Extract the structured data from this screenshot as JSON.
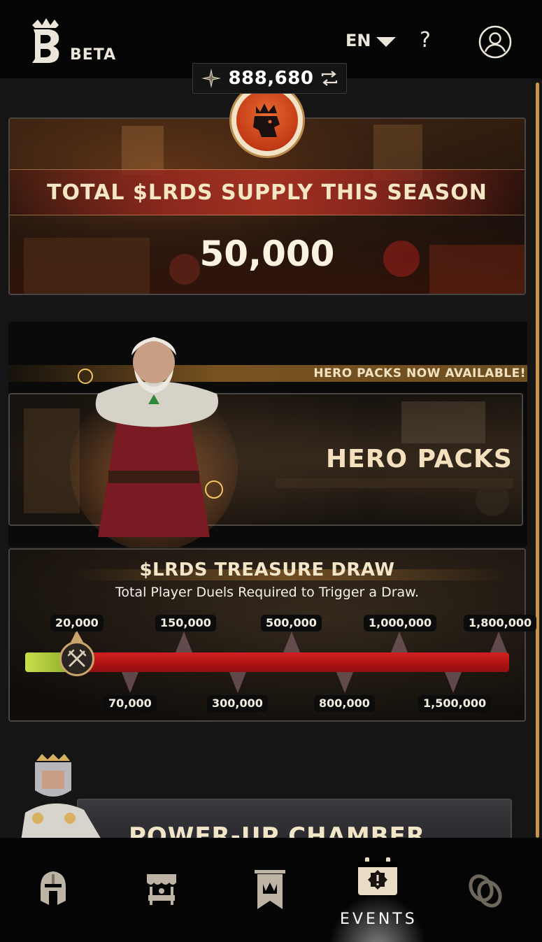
{
  "header": {
    "beta_label": "BETA",
    "language": "EN",
    "help_label": "?"
  },
  "balance": {
    "amount": "888,680"
  },
  "supply_card": {
    "title": "TOTAL $LRDS SUPPLY THIS SEASON",
    "amount": "50,000"
  },
  "hero_packs": {
    "banner": "HERO PACKS NOW AVAILABLE!",
    "title": "HERO PACKS"
  },
  "treasure_draw": {
    "title": "$LRDS TREASURE DRAW",
    "subtitle": "Total Player Duels Required to Trigger a Draw.",
    "milestones_top": [
      "20,000",
      "150,000",
      "500,000",
      "1,000,000",
      "1,800,000"
    ],
    "milestones_bottom": [
      "70,000",
      "300,000",
      "800,000",
      "1,500,000"
    ],
    "progress_fraction": 0.1
  },
  "power_up": {
    "title": "POWER-UP CHAMBER"
  },
  "nav": {
    "items": [
      {
        "icon": "helmet-icon",
        "label": ""
      },
      {
        "icon": "shop-stall-icon",
        "label": ""
      },
      {
        "icon": "banner-crown-icon",
        "label": ""
      },
      {
        "icon": "calendar-event-icon",
        "label": "EVENTS"
      },
      {
        "icon": "rings-icon",
        "label": ""
      }
    ],
    "active_label": "EVENTS"
  },
  "colors": {
    "accent_gold": "#c9a56b",
    "track_red": "#c01818",
    "progress_green": "#a6c43a"
  }
}
